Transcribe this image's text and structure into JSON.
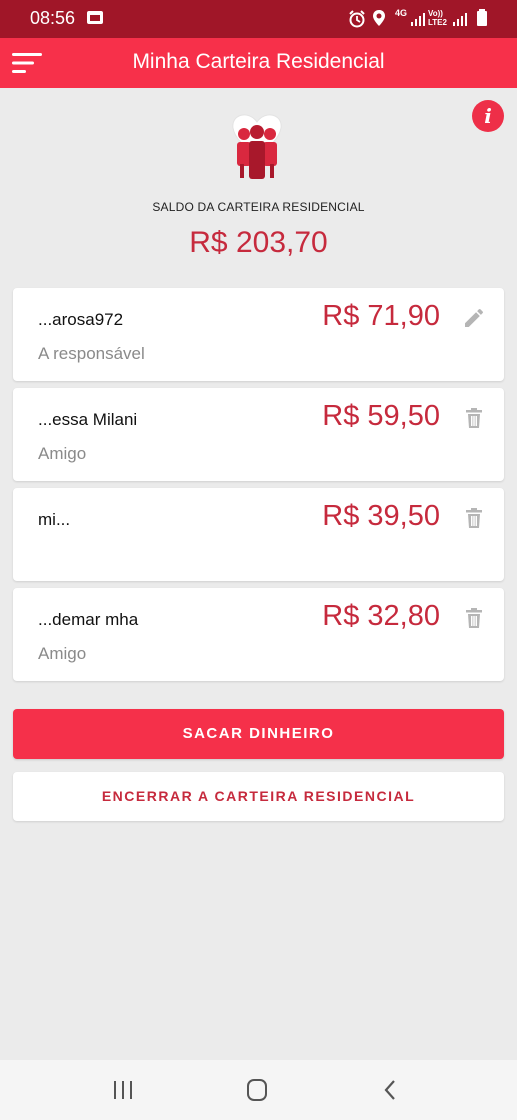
{
  "status_bar": {
    "time": "08:56",
    "network_label": "4G",
    "volte_label": "Vo)) LTE2"
  },
  "app_bar": {
    "title": "Minha Carteira Residencial",
    "color": "#f7304a"
  },
  "info": {
    "glyph": "i"
  },
  "balance": {
    "label": "SALDO DA CARTEIRA RESIDENCIAL",
    "value": "R$ 203,70"
  },
  "members": [
    {
      "name": "...arosa972",
      "role": "A responsável",
      "amount": "R$ 71,90",
      "action_icon": "pencil-icon"
    },
    {
      "name": "...essa Milani",
      "role": "Amigo",
      "amount": "R$ 59,50",
      "action_icon": "trash-icon"
    },
    {
      "name": "mi...",
      "role": "",
      "amount": "R$ 39,50",
      "action_icon": "trash-icon"
    },
    {
      "name": "...demar mha",
      "role": "Amigo",
      "amount": "R$ 32,80",
      "action_icon": "trash-icon"
    }
  ],
  "actions": {
    "withdraw_label": "SACAR DINHEIRO",
    "close_wallet_label": "ENCERRAR A CARTEIRA RESIDENCIAL"
  },
  "colors": {
    "accent": "#f5304a",
    "amount_text": "#c62a3d",
    "status_bar": "#a01628",
    "background": "#ebebeb"
  }
}
